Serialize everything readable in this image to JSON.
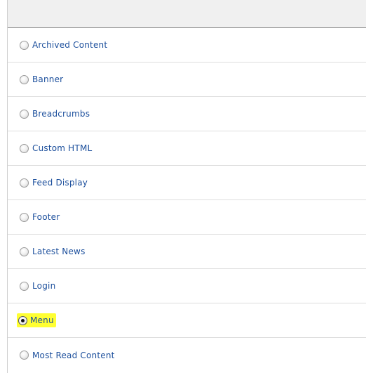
{
  "modules": {
    "items": [
      {
        "label": "Archived Content",
        "selected": false
      },
      {
        "label": "Banner",
        "selected": false
      },
      {
        "label": "Breadcrumbs",
        "selected": false
      },
      {
        "label": "Custom HTML",
        "selected": false
      },
      {
        "label": "Feed Display",
        "selected": false
      },
      {
        "label": "Footer",
        "selected": false
      },
      {
        "label": "Latest News",
        "selected": false
      },
      {
        "label": "Login",
        "selected": false
      },
      {
        "label": "Menu",
        "selected": true
      },
      {
        "label": "Most Read Content",
        "selected": false
      }
    ]
  },
  "colors": {
    "link": "#1c4f9c",
    "highlight": "#ffff33",
    "header_bg": "#f0f0f0"
  }
}
